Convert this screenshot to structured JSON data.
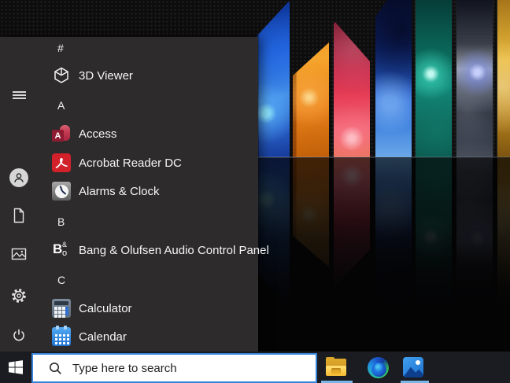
{
  "start_menu": {
    "app_list": [
      {
        "type": "header",
        "label": "#"
      },
      {
        "type": "app",
        "label": "3D Viewer",
        "icon": "3d-cube-icon"
      },
      {
        "type": "header",
        "label": "A"
      },
      {
        "type": "app",
        "label": "Access",
        "icon": "access-icon"
      },
      {
        "type": "app",
        "label": "Acrobat Reader DC",
        "icon": "acrobat-reader-icon"
      },
      {
        "type": "app",
        "label": "Alarms & Clock",
        "icon": "alarm-clock-icon"
      },
      {
        "type": "header",
        "label": "B"
      },
      {
        "type": "app",
        "label": "Bang & Olufsen Audio Control Panel",
        "icon": "bang-olufsen-icon"
      },
      {
        "type": "header",
        "label": "C"
      },
      {
        "type": "app",
        "label": "Calculator",
        "icon": "calculator-icon"
      },
      {
        "type": "app",
        "label": "Calendar",
        "icon": "calendar-icon"
      }
    ],
    "icon_text": {
      "access_letter": "A",
      "bo_b": "B",
      "bo_amp": "&",
      "bo_o": "o"
    },
    "rail": [
      {
        "name": "menu-button",
        "icon": "hamburger-icon"
      },
      {
        "name": "user-account-button",
        "icon": "user-icon"
      },
      {
        "name": "documents-button",
        "icon": "document-icon"
      },
      {
        "name": "pictures-button",
        "icon": "pictures-icon"
      },
      {
        "name": "settings-button",
        "icon": "gear-icon"
      },
      {
        "name": "power-button",
        "icon": "power-icon"
      }
    ]
  },
  "taskbar": {
    "search": {
      "placeholder": "Type here to search",
      "icon": "search-icon"
    },
    "buttons": [
      {
        "name": "start-button",
        "icon": "windows-logo-icon"
      },
      {
        "name": "file-explorer-button",
        "icon": "folder-icon",
        "running": true
      },
      {
        "name": "edge-button",
        "icon": "edge-icon",
        "running": false
      },
      {
        "name": "photos-button",
        "icon": "photos-icon",
        "running": true
      }
    ]
  },
  "colors": {
    "accent_blue": "#3684d9",
    "taskbar_bg": "#1b1c21",
    "start_menu_bg": "#2d2b2c",
    "running_indicator": "#79b7e8",
    "shard_palette": [
      "#1e5fd8",
      "#f5a52d",
      "#e84058",
      "#2a65d8",
      "#12887a",
      "#9aa0a8",
      "#e8b83a"
    ]
  }
}
